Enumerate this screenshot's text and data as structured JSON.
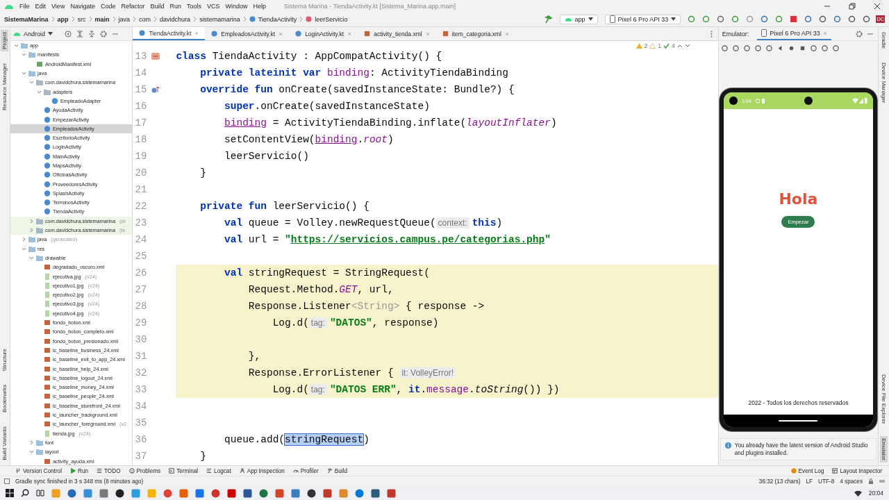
{
  "menu_bar": {
    "items": [
      "File",
      "Edit",
      "View",
      "Navigate",
      "Code",
      "Refactor",
      "Build",
      "Run",
      "Tools",
      "VCS",
      "Window",
      "Help"
    ],
    "title": "Sistema Marina - TiendaActivity.kt [Sistema_Marina.app.main]"
  },
  "breadcrumbs": [
    {
      "label": "SistemaMarina",
      "bold": true,
      "kind": "dir"
    },
    {
      "label": "app",
      "bold": true,
      "kind": "dir"
    },
    {
      "label": "src",
      "bold": false,
      "kind": "dir"
    },
    {
      "label": "main",
      "bold": true,
      "kind": "dir"
    },
    {
      "label": "java",
      "bold": false,
      "kind": "dir"
    },
    {
      "label": "com",
      "bold": false,
      "kind": "dir"
    },
    {
      "label": "davidchura",
      "bold": false,
      "kind": "dir"
    },
    {
      "label": "sistemamarina",
      "bold": false,
      "kind": "dir"
    },
    {
      "label": "TiendaActivity",
      "bold": false,
      "kind": "class"
    },
    {
      "label": "leerServicio",
      "bold": false,
      "kind": "method"
    }
  ],
  "run_toolbar": {
    "configuration": "app",
    "device": "Pixel 6 Pro API 33",
    "account": "DC"
  },
  "left_strip_top": [
    {
      "label": "Project",
      "selected": true
    },
    {
      "label": "Resource Manager",
      "selected": false
    }
  ],
  "left_strip_bottom": [
    {
      "label": "Structure",
      "selected": false
    },
    {
      "label": "Bookmarks",
      "selected": false
    },
    {
      "label": "Build Variants",
      "selected": false
    }
  ],
  "project_panel": {
    "view": "Android",
    "tree": [
      {
        "label": "app",
        "kind": "module",
        "expanded": true,
        "selected": false,
        "children": [
          {
            "label": "manifests",
            "kind": "folder",
            "expanded": true,
            "selected": false,
            "children": [
              {
                "label": "AndroidManifest.xml",
                "kind": "manifest",
                "selected": false
              }
            ]
          },
          {
            "label": "java",
            "kind": "folder",
            "expanded": true,
            "selected": false,
            "children": [
              {
                "label": "com.davidchura.sistemamarina",
                "kind": "package",
                "expanded": true,
                "selected": false,
                "children": [
                  {
                    "label": "adapters",
                    "kind": "package",
                    "expanded": true,
                    "selected": false,
                    "children": [
                      {
                        "label": "EmpleadoAdapter",
                        "kind": "class",
                        "selected": false
                      }
                    ]
                  },
                  {
                    "label": "AyudaActivity",
                    "kind": "class",
                    "selected": false
                  },
                  {
                    "label": "EmpezarActivity",
                    "kind": "class",
                    "selected": false
                  },
                  {
                    "label": "EmpleadosActivity",
                    "kind": "class",
                    "selected": true
                  },
                  {
                    "label": "EscritorioActivity",
                    "kind": "class",
                    "selected": false
                  },
                  {
                    "label": "LoginActivity",
                    "kind": "class",
                    "selected": false
                  },
                  {
                    "label": "MainActivity",
                    "kind": "class",
                    "selected": false
                  },
                  {
                    "label": "MapsActivity",
                    "kind": "class",
                    "selected": false
                  },
                  {
                    "label": "OficinasActivity",
                    "kind": "class",
                    "selected": false
                  },
                  {
                    "label": "ProveedoresActivity",
                    "kind": "class",
                    "selected": false
                  },
                  {
                    "label": "SplashActivity",
                    "kind": "class",
                    "selected": false
                  },
                  {
                    "label": "TerminosActivity",
                    "kind": "class",
                    "selected": false
                  },
                  {
                    "label": "TiendaActivity",
                    "kind": "class",
                    "selected": false
                  }
                ]
              },
              {
                "label": "com.davidchura.sistemamarina",
                "note": "(ar",
                "kind": "package-test",
                "expanded": false,
                "selected": false
              },
              {
                "label": "com.davidchura.sistemamarina",
                "note": "(te",
                "kind": "package-test",
                "expanded": false,
                "selected": false
              }
            ]
          },
          {
            "label": "java",
            "note": "(generated)",
            "kind": "folder",
            "expanded": false,
            "selected": false
          },
          {
            "label": "res",
            "kind": "folder",
            "expanded": true,
            "selected": false,
            "children": [
              {
                "label": "drawable",
                "kind": "folder",
                "expanded": true,
                "selected": false,
                "children": [
                  {
                    "label": "degradado_oscuro.xml",
                    "kind": "xml",
                    "selected": false
                  },
                  {
                    "label": "ejecutiva.jpg",
                    "note": "(v24)",
                    "kind": "image",
                    "selected": false
                  },
                  {
                    "label": "ejecutivo1.jpg",
                    "note": "(v24)",
                    "kind": "image",
                    "selected": false
                  },
                  {
                    "label": "ejecutivo2.jpg",
                    "note": "(v24)",
                    "kind": "image",
                    "selected": false
                  },
                  {
                    "label": "ejecutivo3.jpg",
                    "note": "(v24)",
                    "kind": "image",
                    "selected": false
                  },
                  {
                    "label": "ejecutivo4.jpg",
                    "note": "(v24)",
                    "kind": "image",
                    "selected": false
                  },
                  {
                    "label": "fondo_boton.xml",
                    "kind": "xml",
                    "selected": false
                  },
                  {
                    "label": "fondo_boton_completo.xml",
                    "kind": "xml",
                    "selected": false
                  },
                  {
                    "label": "fondo_boton_presionado.xml",
                    "kind": "xml",
                    "selected": false
                  },
                  {
                    "label": "ic_baseline_business_24.xml",
                    "kind": "xml",
                    "selected": false
                  },
                  {
                    "label": "ic_baseline_exit_to_app_24.xml",
                    "kind": "xml",
                    "selected": false
                  },
                  {
                    "label": "ic_baseline_help_24.xml",
                    "kind": "xml",
                    "selected": false
                  },
                  {
                    "label": "ic_baseline_logout_24.xml",
                    "kind": "xml",
                    "selected": false
                  },
                  {
                    "label": "ic_baseline_money_24.xml",
                    "kind": "xml",
                    "selected": false
                  },
                  {
                    "label": "ic_baseline_people_24.xml",
                    "kind": "xml",
                    "selected": false
                  },
                  {
                    "label": "ic_baseline_storefront_24.xml",
                    "kind": "xml",
                    "selected": false
                  },
                  {
                    "label": "ic_launcher_background.xml",
                    "kind": "xml",
                    "selected": false
                  },
                  {
                    "label": "ic_launcher_foreground.xml",
                    "note": "(v2",
                    "kind": "xml",
                    "selected": false
                  },
                  {
                    "label": "tienda.jpg",
                    "note": "(v24)",
                    "kind": "image",
                    "selected": false
                  }
                ]
              },
              {
                "label": "font",
                "kind": "folder",
                "expanded": false,
                "selected": false
              },
              {
                "label": "layout",
                "kind": "folder",
                "expanded": true,
                "selected": false,
                "children": [
                  {
                    "label": "activity_ayuda.xml",
                    "kind": "xml",
                    "selected": false
                  }
                ]
              }
            ]
          }
        ]
      }
    ]
  },
  "editor": {
    "tabs": [
      {
        "label": "TiendaActivity.kt",
        "kind": "kotlin",
        "selected": true
      },
      {
        "label": "EmpleadosActivity.kt",
        "kind": "kotlin",
        "selected": false
      },
      {
        "label": "LoginActivity.kt",
        "kind": "kotlin",
        "selected": false
      },
      {
        "label": "activity_tienda.xml",
        "kind": "xml",
        "selected": false
      },
      {
        "label": "item_categoria.xml",
        "kind": "xml",
        "selected": false
      }
    ],
    "inspections": {
      "warnings": "2",
      "weak_warnings": "1",
      "passed": "4"
    },
    "lines": [
      {
        "number": "13",
        "kind": "class",
        "highlighted": false,
        "tokens": [
          {
            "text": "class ",
            "kind": "kw"
          },
          {
            "text": "TiendaActivity : AppCompatActivity() {",
            "kind": "plain"
          }
        ]
      },
      {
        "number": "14",
        "highlighted": false,
        "tokens": [
          {
            "text": "    private lateinit var ",
            "kind": "kw"
          },
          {
            "text": "binding",
            "kind": "prop"
          },
          {
            "text": ": ActivityTiendaBinding",
            "kind": "plain"
          }
        ]
      },
      {
        "number": "15",
        "kind": "override",
        "highlighted": false,
        "tokens": [
          {
            "text": "    override fun ",
            "kind": "kw"
          },
          {
            "text": "onCreate(savedInstanceState: Bundle?) {",
            "kind": "plain"
          }
        ]
      },
      {
        "number": "16",
        "highlighted": false,
        "tokens": [
          {
            "text": "        super",
            "kind": "kw"
          },
          {
            "text": ".onCreate(savedInstanceState)",
            "kind": "plain"
          }
        ]
      },
      {
        "number": "17",
        "highlighted": false,
        "tokens": [
          {
            "text": "        binding",
            "kind": "prop-u"
          },
          {
            "text": " = ActivityTiendaBinding.inflate(",
            "kind": "plain"
          },
          {
            "text": "layoutInflater",
            "kind": "prop-i"
          },
          {
            "text": ")",
            "kind": "plain"
          }
        ]
      },
      {
        "number": "18",
        "highlighted": false,
        "tokens": [
          {
            "text": "        setContentView(",
            "kind": "plain"
          },
          {
            "text": "binding",
            "kind": "prop-u"
          },
          {
            "text": ".",
            "kind": "plain"
          },
          {
            "text": "root",
            "kind": "prop-i"
          },
          {
            "text": ")",
            "kind": "plain"
          }
        ]
      },
      {
        "number": "19",
        "highlighted": false,
        "tokens": [
          {
            "text": "        leerServicio()",
            "kind": "plain"
          }
        ]
      },
      {
        "number": "20",
        "highlighted": false,
        "tokens": [
          {
            "text": "    }",
            "kind": "plain"
          }
        ]
      },
      {
        "number": "21",
        "highlighted": false
      },
      {
        "number": "22",
        "highlighted": false,
        "tokens": [
          {
            "text": "    private fun ",
            "kind": "kw"
          },
          {
            "text": "leerServicio() {",
            "kind": "plain"
          }
        ]
      },
      {
        "number": "23",
        "highlighted": false,
        "tokens": [
          {
            "text": "        val ",
            "kind": "kw"
          },
          {
            "text": "queue = Volley.newRequestQueue(",
            "kind": "plain"
          },
          {
            "text": "context:",
            "kind": "hint"
          },
          {
            "text": "this",
            "kind": "kw"
          },
          {
            "text": ")",
            "kind": "plain"
          }
        ]
      },
      {
        "number": "24",
        "highlighted": false,
        "tokens": [
          {
            "text": "        val ",
            "kind": "kw"
          },
          {
            "text": "url = ",
            "kind": "plain"
          },
          {
            "text": "\"",
            "kind": "str"
          },
          {
            "text": "https://servicios.campus.pe/categorias.php",
            "kind": "url"
          },
          {
            "text": "\"",
            "kind": "str"
          }
        ]
      },
      {
        "number": "25",
        "highlighted": false
      },
      {
        "number": "26",
        "highlighted": true,
        "tokens": [
          {
            "text": "        val ",
            "kind": "kw"
          },
          {
            "text": "stringRequest = StringRequest(",
            "kind": "plain"
          }
        ]
      },
      {
        "number": "27",
        "highlighted": true,
        "tokens": [
          {
            "text": "            Request.Method.",
            "kind": "plain"
          },
          {
            "text": "GET",
            "kind": "prop-i"
          },
          {
            "text": ", url,",
            "kind": "plain"
          }
        ]
      },
      {
        "number": "28",
        "highlighted": true,
        "tokens": [
          {
            "text": "            Response.Listener",
            "kind": "plain"
          },
          {
            "text": "<String>",
            "kind": "type"
          },
          {
            "text": " { response ->",
            "kind": "plain"
          }
        ]
      },
      {
        "number": "29",
        "highlighted": true,
        "tokens": [
          {
            "text": "                Log.d(",
            "kind": "plain"
          },
          {
            "text": "tag:",
            "kind": "hint"
          },
          {
            "text": "\"DATOS\"",
            "kind": "str"
          },
          {
            "text": ", response)",
            "kind": "plain"
          }
        ]
      },
      {
        "number": "30",
        "highlighted": true
      },
      {
        "number": "31",
        "highlighted": true,
        "tokens": [
          {
            "text": "            },",
            "kind": "plain"
          }
        ]
      },
      {
        "number": "32",
        "highlighted": true,
        "tokens": [
          {
            "text": "            Response.ErrorListener { ",
            "kind": "plain"
          },
          {
            "text": "it: VolleyError!",
            "kind": "hint"
          }
        ]
      },
      {
        "number": "33",
        "highlighted": true,
        "tokens": [
          {
            "text": "                Log.d(",
            "kind": "plain"
          },
          {
            "text": "tag:",
            "kind": "hint"
          },
          {
            "text": "\"DATOS ERR\"",
            "kind": "str"
          },
          {
            "text": ", ",
            "kind": "plain"
          },
          {
            "text": "it",
            "kind": "kw"
          },
          {
            "text": ".",
            "kind": "plain"
          },
          {
            "text": "message",
            "kind": "prop"
          },
          {
            "text": ".",
            "kind": "plain"
          },
          {
            "text": "toString",
            "kind": "ital"
          },
          {
            "text": "()) })",
            "kind": "plain"
          }
        ]
      },
      {
        "number": "34",
        "highlighted": false
      },
      {
        "number": "35",
        "highlighted": false
      },
      {
        "number": "36",
        "highlighted": false,
        "tokens": [
          {
            "text": "        queue.add(",
            "kind": "plain"
          },
          {
            "text": "stringRequest",
            "kind": "sel"
          },
          {
            "text": ")",
            "kind": "plain"
          }
        ]
      },
      {
        "number": "37",
        "highlighted": false,
        "tokens": [
          {
            "text": "    }",
            "kind": "plain"
          }
        ]
      }
    ]
  },
  "emulator": {
    "label": "Emulator:",
    "tab": "Pixel 6 Pro API 33",
    "phone": {
      "time": "1:04",
      "title": "Hola",
      "button": "Empezar",
      "footer": "2022 - Todos los derechos reservados"
    },
    "notification": "You already have the latest version of Android Studio and plugins installed."
  },
  "right_strip_top": [
    {
      "label": "Gradle",
      "selected": false
    },
    {
      "label": "Device Manager",
      "selected": false
    }
  ],
  "right_strip_bottom": [
    {
      "label": "Device File Explorer",
      "selected": false
    },
    {
      "label": "Emulator",
      "selected": true
    }
  ],
  "tool_windows": [
    {
      "label": "Version Control",
      "kind": "vcs"
    },
    {
      "label": "Run",
      "kind": "run"
    },
    {
      "label": "TODO",
      "kind": "todo"
    },
    {
      "label": "Problems",
      "kind": "problems"
    },
    {
      "label": "Terminal",
      "kind": "terminal"
    },
    {
      "label": "Logcat",
      "kind": "logcat"
    },
    {
      "label": "App Inspection",
      "kind": "inspection"
    },
    {
      "label": "Profiler",
      "kind": "profiler"
    },
    {
      "label": "Build",
      "kind": "build"
    }
  ],
  "tool_windows_right": [
    {
      "label": "Event Log",
      "kind": "event"
    },
    {
      "label": "Layout Inspector",
      "kind": "layout"
    }
  ],
  "status_bar": {
    "message": "Gradle sync finished in 3 s 348 ms (8 minutes ago)",
    "items": [
      "36:32 (13 chars)",
      "LF",
      "UTF-8",
      "4 spaces"
    ]
  },
  "taskbar": {
    "time": "20:04"
  }
}
